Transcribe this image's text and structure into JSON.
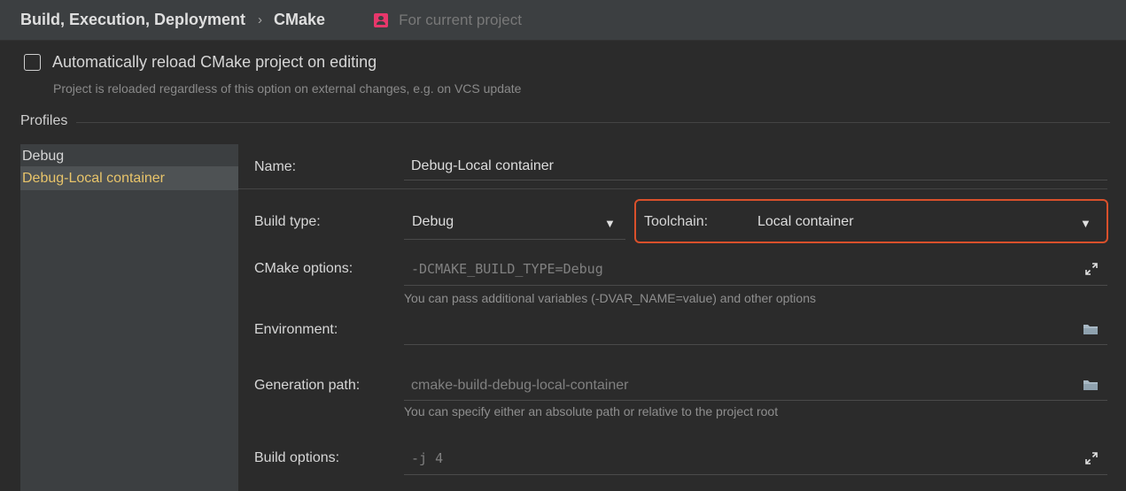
{
  "header": {
    "section": "Build, Execution, Deployment",
    "separator": "›",
    "page": "CMake",
    "scope_label": "For current project"
  },
  "auto_reload": {
    "label": "Automatically reload CMake project on editing",
    "checked": false,
    "hint": "Project is reloaded regardless of this option on external changes, e.g. on VCS update"
  },
  "profiles": {
    "title": "Profiles",
    "items": [
      {
        "label": "Debug",
        "selected": false
      },
      {
        "label": "Debug-Local container",
        "selected": true
      }
    ]
  },
  "form": {
    "name": {
      "label": "Name:",
      "value": "Debug-Local container"
    },
    "build_type": {
      "label": "Build type:",
      "value": "Debug"
    },
    "toolchain": {
      "label": "Toolchain:",
      "value": "Local container"
    },
    "cmake_options": {
      "label": "CMake options:",
      "value": "-DCMAKE_BUILD_TYPE=Debug",
      "hint": "You can pass additional variables (-DVAR_NAME=value) and other options"
    },
    "environment": {
      "label": "Environment:",
      "value": ""
    },
    "generation_path": {
      "label": "Generation path:",
      "placeholder": "cmake-build-debug-local-container",
      "hint": "You can specify either an absolute path or relative to the project root"
    },
    "build_options": {
      "label": "Build options:",
      "value": "-j 4"
    }
  },
  "colors": {
    "highlight_border": "#d9502b",
    "selected_profile": "#e8c46a",
    "scope_icon": "#e8376b"
  }
}
